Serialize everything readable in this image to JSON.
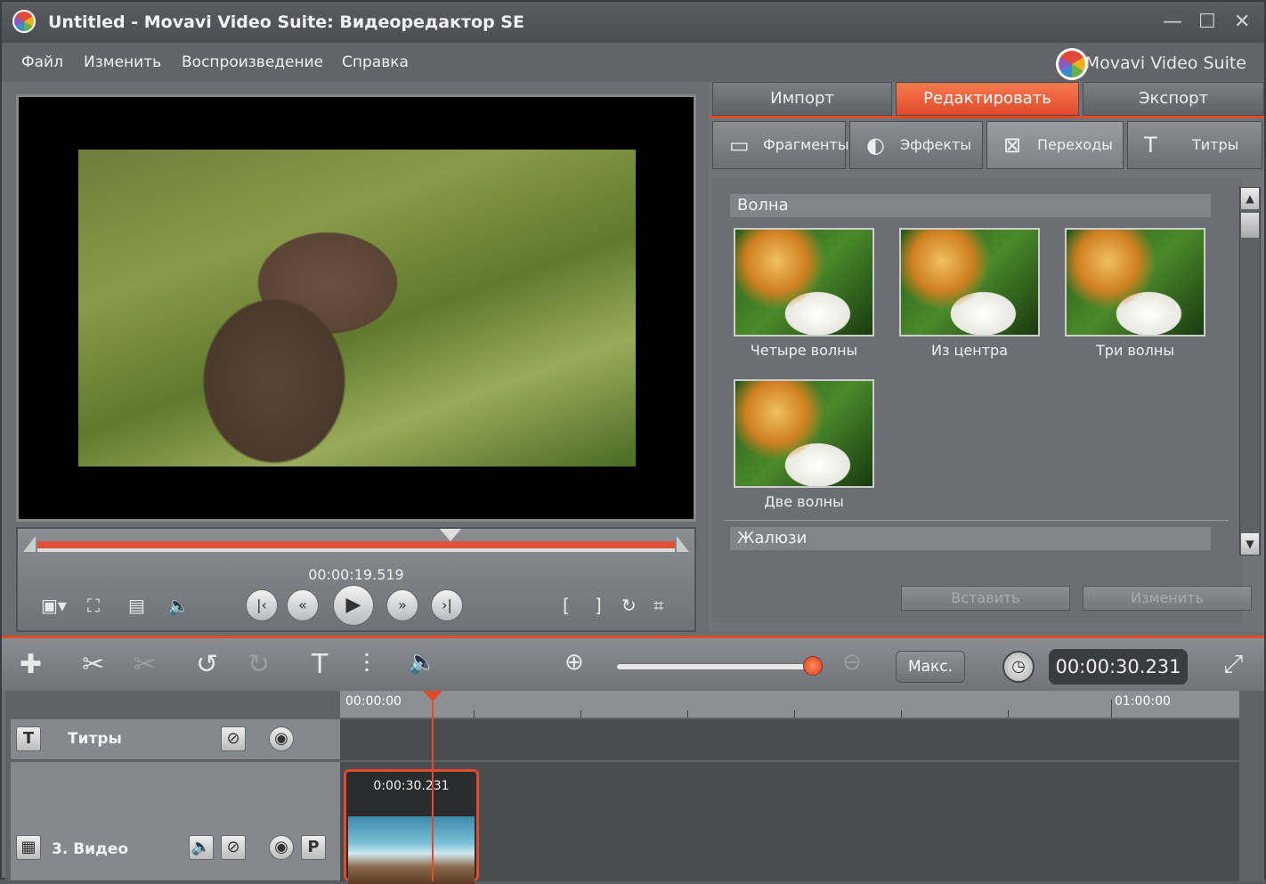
{
  "window": {
    "title": "Untitled - Movavi Video Suite: Видеоредактор SE",
    "brand": "Movavi Video Suite",
    "controls": [
      "—",
      "☐",
      "✕"
    ]
  },
  "menu": [
    "Файл",
    "Изменить",
    "Воспроизведение",
    "Справка"
  ],
  "player": {
    "timecode": "00:00:19.519",
    "progress": 1.0,
    "buttons": {
      "prev_frame": "|‹",
      "rewind": "«",
      "play": "▶",
      "forward": "»",
      "next_frame": "›|"
    }
  },
  "tabs": [
    {
      "label": "Импорт",
      "active": false
    },
    {
      "label": "Редактировать",
      "active": true
    },
    {
      "label": "Экспорт",
      "active": false
    }
  ],
  "subtabs": [
    {
      "label": "Фрагменты",
      "icon": "fragments-icon",
      "active": false
    },
    {
      "label": "Эффекты",
      "icon": "effects-icon",
      "active": false
    },
    {
      "label": "Переходы",
      "icon": "transitions-icon",
      "active": true
    },
    {
      "label": "Титры",
      "icon": "titles-icon",
      "active": false
    }
  ],
  "transitions": {
    "group1": "Волна",
    "items": [
      "Четыре волны",
      "Из центра",
      "Три волны",
      "Две волны"
    ],
    "group2": "Жалюзи",
    "insert_label": "Вставить",
    "edit_label": "Изменить"
  },
  "toolbar": {
    "max_label": "Макс.",
    "duration": "00:00:30.231",
    "zoom_level": 0.95
  },
  "timeline": {
    "ruler_start": "00:00:00",
    "ruler_end": "01:00:00",
    "tracks": [
      {
        "name": "Титры"
      },
      {
        "name": "3. Видео"
      }
    ],
    "clip_time": "0:00:30.231",
    "title_icon": "T",
    "p_label": "P"
  },
  "colors": {
    "accent": "#e24a2a",
    "panel": "#6b6e72"
  }
}
